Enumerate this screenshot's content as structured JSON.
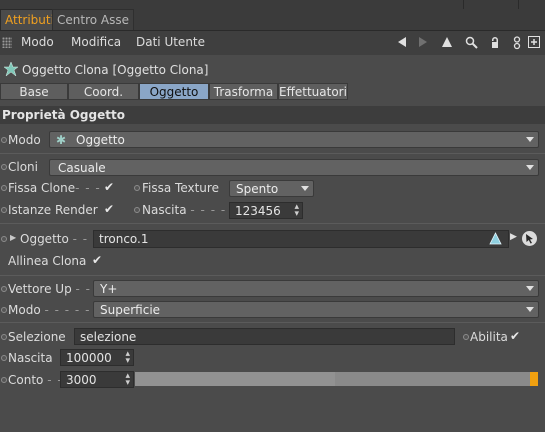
{
  "tabs": [
    {
      "label": "Attributi",
      "active": true
    },
    {
      "label": "Centro Asse",
      "active": false
    }
  ],
  "menu": {
    "items": [
      "Modo",
      "Modifica",
      "Dati Utente"
    ],
    "icons": [
      "arrow-left-icon",
      "arrow-right-icon",
      "arrow-up-icon",
      "search-icon",
      "lock-icon",
      "node-icon",
      "new-window-icon"
    ]
  },
  "object": {
    "title": "Oggetto Clona [Oggetto Clona]",
    "icon": "cloner-icon"
  },
  "attr_tabs": [
    {
      "label": "Base",
      "active": false
    },
    {
      "label": "Coord.",
      "active": false
    },
    {
      "label": "Oggetto",
      "active": true
    },
    {
      "label": "Trasforma",
      "active": false
    },
    {
      "label": "Effettuatori",
      "active": false
    }
  ],
  "section": {
    "title": "Proprietà Oggetto"
  },
  "fields": {
    "modo": {
      "label": "Modo",
      "value": "Oggetto"
    },
    "cloni": {
      "label": "Cloni",
      "value": "Casuale"
    },
    "fissa_clone": {
      "label": "Fissa Clone",
      "dots": "- - -",
      "checked": "✔"
    },
    "fissa_texture": {
      "label": "Fissa Texture",
      "value": "Spento"
    },
    "istanze_render": {
      "label": "Istanze Render",
      "checked": "✔"
    },
    "nascita_seed": {
      "label": "Nascita",
      "dots": "- - - - - -",
      "value": "123456"
    },
    "oggetto": {
      "label": "Oggetto",
      "dots": "- - -",
      "value": "tronco.1"
    },
    "allinea_clona": {
      "label": "Allinea Clona",
      "checked": "✔"
    },
    "vettore_up": {
      "label": "Vettore Up",
      "dots": "- -",
      "value": "Y+"
    },
    "modo2": {
      "label": "Modo",
      "dots": "- - - - - - -",
      "value": "Superficie"
    },
    "selezione": {
      "label": "Selezione",
      "value": "selezione"
    },
    "abilita": {
      "label": "Abilita",
      "checked": "✔"
    },
    "nascita": {
      "label": "Nascita",
      "value": "100000"
    },
    "conto": {
      "label": "Conto",
      "dots": "- -",
      "value": "3000"
    }
  },
  "colors": {
    "accent": "#f0a020",
    "active_tab": "#8aa6c7",
    "slider_end": "#f0a010"
  }
}
